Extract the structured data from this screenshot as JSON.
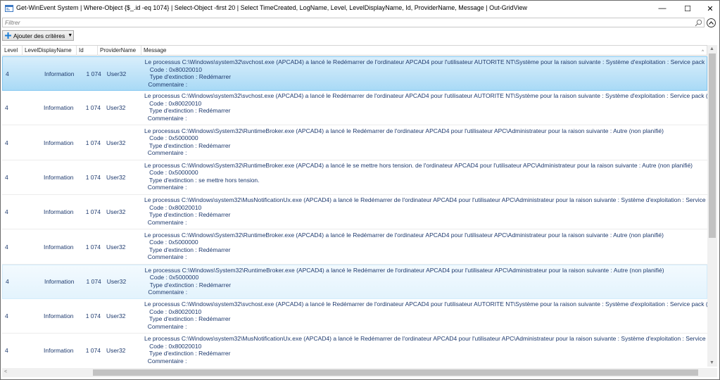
{
  "window": {
    "title": "Get-WinEvent System | Where-Object {$_.id -eq 1074} | Select-Object -first 20 | Select TimeCreated, LogName, Level, LevelDisplayName, Id, ProviderName, Message | Out-GridView",
    "minimize_glyph": "—",
    "maximize_glyph": "☐",
    "close_glyph": "✕"
  },
  "filter": {
    "placeholder": "Filtrer"
  },
  "toolbar": {
    "add_criteria_label": "Ajouter des critères",
    "dropdown_glyph": "▼"
  },
  "columns": [
    "Level",
    "LevelDisplayName",
    "Id",
    "ProviderName",
    "Message"
  ],
  "rows": [
    {
      "level": "4",
      "level_display_name": "Information",
      "id": "1 074",
      "provider": "User32",
      "message": [
        "Le processus C:\\Windows\\system32\\svchost.exe (APCAD4) a lancé le Redémarrer de l'ordinateur APCAD4 pour l'utilisateur AUTORITE NT\\Système pour la raison suivante : Système d'exploitation : Service pack (Pla",
        "   Code : 0x80020010",
        "   Type d'extinction : Redémarrer",
        "  Commentaire :"
      ]
    },
    {
      "level": "4",
      "level_display_name": "Information",
      "id": "1 074",
      "provider": "User32",
      "message": [
        "Le processus C:\\Windows\\system32\\svchost.exe (APCAD4) a lancé le Redémarrer de l'ordinateur APCAD4 pour l'utilisateur AUTORITE NT\\Système pour la raison suivante : Système d'exploitation : Service pack (Pla",
        "   Code : 0x80020010",
        "   Type d'extinction : Redémarrer",
        "  Commentaire :"
      ]
    },
    {
      "level": "4",
      "level_display_name": "Information",
      "id": "1 074",
      "provider": "User32",
      "message": [
        "Le processus C:\\Windows\\System32\\RuntimeBroker.exe (APCAD4) a lancé le Redémarrer de l'ordinateur APCAD4 pour l'utilisateur APC\\Administrateur pour la raison suivante : Autre (non planifié)",
        "   Code : 0x5000000",
        "   Type d'extinction : Redémarrer",
        "  Commentaire :"
      ]
    },
    {
      "level": "4",
      "level_display_name": "Information",
      "id": "1 074",
      "provider": "User32",
      "message": [
        "Le processus C:\\Windows\\System32\\RuntimeBroker.exe (APCAD4) a lancé le se mettre hors tension. de l'ordinateur APCAD4 pour l'utilisateur APC\\Administrateur pour la raison suivante : Autre (non planifié)",
        "   Code : 0x5000000",
        "   Type d'extinction : se mettre hors tension.",
        "  Commentaire :"
      ]
    },
    {
      "level": "4",
      "level_display_name": "Information",
      "id": "1 074",
      "provider": "User32",
      "message": [
        "Le processus C:\\Windows\\system32\\MusNotificationUx.exe (APCAD4) a lancé le Redémarrer de l'ordinateur APCAD4 pour l'utilisateur APC\\Administrateur pour la raison suivante : Système d'exploitation : Service",
        "   Code : 0x80020010",
        "   Type d'extinction : Redémarrer",
        "  Commentaire :"
      ]
    },
    {
      "level": "4",
      "level_display_name": "Information",
      "id": "1 074",
      "provider": "User32",
      "message": [
        "Le processus C:\\Windows\\System32\\RuntimeBroker.exe (APCAD4) a lancé le Redémarrer de l'ordinateur APCAD4 pour l'utilisateur APC\\Administrateur pour la raison suivante : Autre (non planifié)",
        "   Code : 0x5000000",
        "   Type d'extinction : Redémarrer",
        "  Commentaire :"
      ]
    },
    {
      "level": "4",
      "level_display_name": "Information",
      "id": "1 074",
      "provider": "User32",
      "message": [
        "Le processus C:\\Windows\\System32\\RuntimeBroker.exe (APCAD4) a lancé le Redémarrer de l'ordinateur APCAD4 pour l'utilisateur APC\\Administrateur pour la raison suivante : Autre (non planifié)",
        "   Code : 0x5000000",
        "   Type d'extinction : Redémarrer",
        "  Commentaire :"
      ]
    },
    {
      "level": "4",
      "level_display_name": "Information",
      "id": "1 074",
      "provider": "User32",
      "message": [
        "Le processus C:\\Windows\\system32\\svchost.exe (APCAD4) a lancé le Redémarrer de l'ordinateur APCAD4 pour l'utilisateur AUTORITE NT\\Système pour la raison suivante : Système d'exploitation : Service pack (Pla",
        "   Code : 0x80020010",
        "   Type d'extinction : Redémarrer",
        "  Commentaire :"
      ]
    },
    {
      "level": "4",
      "level_display_name": "Information",
      "id": "1 074",
      "provider": "User32",
      "message": [
        "Le processus C:\\Windows\\system32\\MusNotificationUx.exe (APCAD4) a lancé le Redémarrer de l'ordinateur APCAD4 pour l'utilisateur APC\\Administrateur pour la raison suivante : Système d'exploitation : Service",
        "   Code : 0x80020010",
        "   Type d'extinction : Redémarrer",
        "  Commentaire :"
      ]
    }
  ],
  "row_states": {
    "selected_row": 0,
    "hover_row": 6
  },
  "colors": {
    "selected_row": "#a9daf6",
    "hover_row": "#e3f3fd",
    "text": "#1e3a6e"
  }
}
